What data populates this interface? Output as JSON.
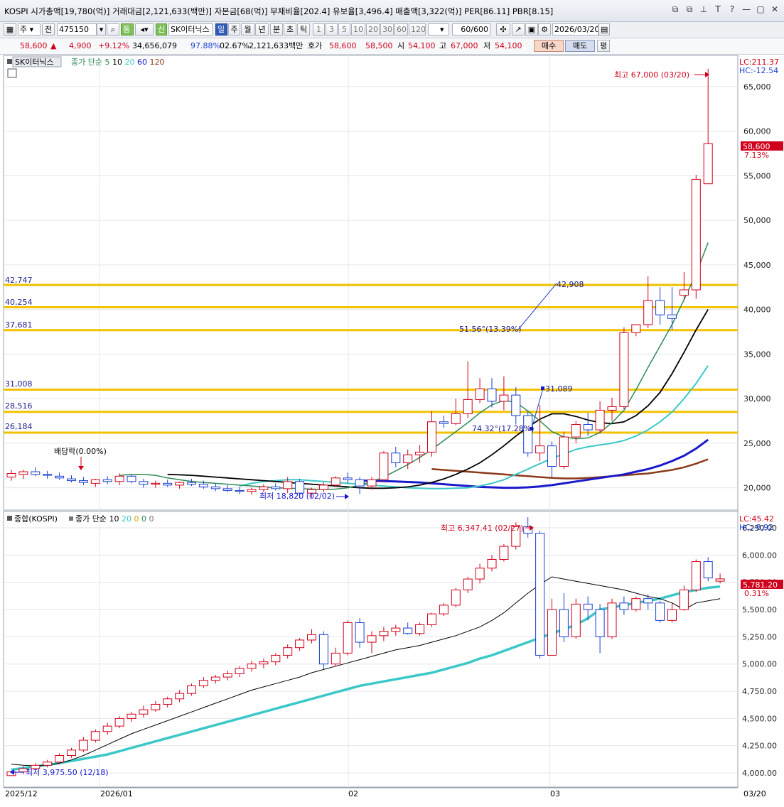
{
  "header": {
    "title": "KOSPI 시가총액[19,780(억)] 거래대금[2,121,633(백만)] 자본금[68(억)] 부채비율[202.4] 유보율[3,496.4] 매출액[3,322(억)] PER[86.11] PBR[8.15]",
    "window_icons": [
      "⧉",
      "⧉",
      "⊥",
      "T",
      "?",
      "—",
      "▢",
      "✕"
    ]
  },
  "toolbar": {
    "period_select": "주",
    "prev_label": "전",
    "code": "475150",
    "tong_label": "통",
    "sin_label": "신",
    "stock_name": "SK이터닉스",
    "period_tabs": [
      "일",
      "주",
      "월",
      "년",
      "분",
      "초",
      "틱"
    ],
    "active_period": "일",
    "interval_buttons": [
      "1",
      "3",
      "5",
      "10",
      "20",
      "30",
      "60",
      "120"
    ],
    "count_value": "60",
    "count_total": "/600",
    "date": "2026/03/20"
  },
  "quote": {
    "price": "58,600",
    "change_arrow": "▲",
    "change": "4,900",
    "change_pct": "+9.12%",
    "volume": "34,656,079",
    "vol_ratio": "97.88%",
    "turnover": "02.67%",
    "amount": "2,121,633백만",
    "hoga_label": "호가",
    "ask": "58,600",
    "bid": "58,500",
    "open_label": "시",
    "open": "54,100",
    "high_label": "고",
    "high": "67,000",
    "low_label": "저",
    "low": "54,100",
    "buy_label": "매수",
    "sell_label": "매도",
    "eval_label": "평"
  },
  "upper_panel": {
    "legend_name": "SK이터닉스",
    "legend_ma": "종가 단순",
    "ma_periods": [
      "5",
      "10",
      "20",
      "60",
      "120"
    ],
    "ma_colors": [
      "#2e8b57",
      "#000000",
      "#3cc8c8",
      "#1a1acc",
      "#8b3a1a"
    ],
    "lc": "LC:211.37",
    "hc": "HC:-12.54",
    "current_price": "58,600",
    "current_pct": "7.13%",
    "high_annotation": "최고 67,000 (03/20)",
    "low_annotation": "최저 18,820 (02/02)",
    "dividend": "배당락(0.00%)",
    "fib_levels": [
      "42,747",
      "40,254",
      "37,681",
      "31,008",
      "28,516",
      "26,184"
    ],
    "trend_label_1": "42,908",
    "trend_label_2": "51.56°(13.39%)",
    "trend_label_3": "31,089",
    "trend_label_4": "74.32°(17.28%)",
    "y_ticks": [
      "65,000",
      "60,000",
      "55,000",
      "50,000",
      "45,000",
      "40,000",
      "35,000",
      "30,000",
      "25,000",
      "20,000"
    ]
  },
  "lower_panel": {
    "legend_name": "종합(KOSPI)",
    "legend_ma": "종가 단순",
    "ma_periods": [
      "10",
      "20",
      "0",
      "0",
      "0"
    ],
    "lc": "LC:45.42",
    "hc": "HC:-8.92",
    "current_value": "5,781.20",
    "current_pct": "0.31%",
    "high_annotation": "최고 6,347.41 (02/27)",
    "low_annotation": "최저 3,975.50 (12/18)",
    "y_ticks": [
      "6,250.00",
      "6,000.00",
      "5,750.00",
      "5,500.00",
      "5,250.00",
      "5,000.00",
      "4,750.00",
      "4,500.00",
      "4,250.00",
      "4,000.00"
    ]
  },
  "x_axis": {
    "labels": [
      "2025/12",
      "2026/01",
      "02",
      "03",
      "03/20"
    ]
  },
  "chart_data": [
    {
      "type": "candlestick",
      "title": "SK이터닉스",
      "ylim": [
        17500,
        68500
      ],
      "x_labels": [
        "2025/12",
        "2026/01",
        "02",
        "03"
      ],
      "ohlc": [
        [
          21200,
          22000,
          20800,
          21600
        ],
        [
          21500,
          22000,
          21000,
          21800
        ],
        [
          21800,
          22300,
          21300,
          21500
        ],
        [
          21500,
          21900,
          21000,
          21400
        ],
        [
          21300,
          21700,
          20900,
          21100
        ],
        [
          21000,
          21400,
          20600,
          20800
        ],
        [
          20800,
          21200,
          20300,
          20600
        ],
        [
          20500,
          21000,
          20100,
          20900
        ],
        [
          20900,
          21300,
          20400,
          20700
        ],
        [
          20700,
          21600,
          20300,
          21300
        ],
        [
          21300,
          21500,
          20500,
          20700
        ],
        [
          20700,
          21000,
          20000,
          20400
        ],
        [
          20400,
          20800,
          20000,
          20500
        ],
        [
          20500,
          20900,
          20100,
          20300
        ],
        [
          20300,
          20700,
          19900,
          20600
        ],
        [
          20600,
          21000,
          20200,
          20400
        ],
        [
          20400,
          20800,
          19900,
          20100
        ],
        [
          20100,
          20500,
          19600,
          19900
        ],
        [
          19900,
          20300,
          19500,
          19700
        ],
        [
          19700,
          20100,
          19300,
          19600
        ],
        [
          19600,
          20000,
          19200,
          19800
        ],
        [
          19800,
          20400,
          19500,
          20100
        ],
        [
          20100,
          20500,
          19700,
          19900
        ],
        [
          19900,
          21200,
          19400,
          20700
        ],
        [
          20700,
          21000,
          18820,
          19400
        ],
        [
          19400,
          20000,
          18900,
          19800
        ],
        [
          19800,
          20600,
          19500,
          20300
        ],
        [
          20300,
          21300,
          20100,
          21100
        ],
        [
          21100,
          21700,
          20500,
          20900
        ],
        [
          20900,
          21200,
          19300,
          20200
        ],
        [
          20200,
          21200,
          19800,
          20900
        ],
        [
          20900,
          24100,
          20700,
          23900
        ],
        [
          23900,
          24600,
          22300,
          22800
        ],
        [
          22800,
          24300,
          22100,
          23700
        ],
        [
          23700,
          24800,
          22800,
          24000
        ],
        [
          24000,
          28600,
          23500,
          27400
        ],
        [
          27400,
          28100,
          26700,
          27200
        ],
        [
          27200,
          30000,
          27000,
          28300
        ],
        [
          28300,
          34200,
          27800,
          29900
        ],
        [
          29900,
          32300,
          29500,
          31100
        ],
        [
          31100,
          32300,
          29000,
          29700
        ],
        [
          29700,
          32500,
          28700,
          30400
        ],
        [
          30400,
          31300,
          27100,
          28100
        ],
        [
          28100,
          28600,
          23500,
          23900
        ],
        [
          23900,
          29300,
          23000,
          24700
        ],
        [
          24700,
          25200,
          21200,
          22400
        ],
        [
          22400,
          26300,
          22100,
          25700
        ],
        [
          25700,
          27500,
          25000,
          27100
        ],
        [
          27100,
          28400,
          25800,
          26500
        ],
        [
          26500,
          29700,
          26100,
          28700
        ],
        [
          28700,
          30100,
          27500,
          29100
        ],
        [
          29100,
          38000,
          28800,
          37400
        ],
        [
          37400,
          38200,
          37000,
          38300
        ],
        [
          38300,
          43700,
          37900,
          41000
        ],
        [
          41000,
          42500,
          38300,
          39400
        ],
        [
          39400,
          42500,
          37700,
          39000
        ],
        [
          41600,
          44200,
          41100,
          42200
        ],
        [
          42200,
          55100,
          41200,
          54600
        ],
        [
          54100,
          67000,
          54100,
          58600
        ]
      ],
      "ma5": [
        21400,
        21500,
        21500,
        21400,
        21100,
        20900,
        20700,
        20600,
        20500,
        20400,
        20300,
        20200,
        20100,
        20000,
        19950,
        19900,
        19850,
        19800,
        19850,
        20000,
        20300,
        20700,
        21200,
        21900,
        22600,
        23400,
        24300,
        25300,
        26300,
        27300,
        28400,
        29300,
        29800,
        29600,
        28600,
        27500,
        26300,
        25700,
        25500,
        25600,
        26200,
        27300,
        28700,
        31000,
        33500,
        35900,
        38300,
        41100,
        44000,
        47500
      ],
      "ma10": [
        21500,
        21450,
        21400,
        21300,
        21200,
        21100,
        21000,
        20900,
        20800,
        20700,
        20600,
        20500,
        20400,
        20300,
        20200,
        20100,
        20000,
        19950,
        19950,
        20000,
        20100,
        20300,
        20600,
        21000,
        21500,
        22100,
        22800,
        23700,
        24700,
        25800,
        26800,
        27700,
        28300,
        28300,
        28000,
        27600,
        27300,
        27200,
        27400,
        28100,
        29200,
        30700,
        32800,
        35200,
        37700,
        40000
      ],
      "ma20": [
        20200,
        20500,
        20700,
        20800,
        20900,
        20900,
        20800,
        20700,
        20600,
        20500,
        20400,
        20300,
        20200,
        20100,
        20000,
        19950,
        19900,
        19900,
        19950,
        20000,
        20200,
        20500,
        20900,
        21500,
        22100,
        22700,
        23300,
        23800,
        24300,
        24600,
        24800,
        25000,
        25300,
        25800,
        26500,
        27400,
        28500,
        30000,
        31700,
        33700
      ],
      "ma60": [
        20800,
        20800,
        20750,
        20700,
        20650,
        20600,
        20500,
        20400,
        20300,
        20200,
        20100,
        20050,
        20000,
        20000,
        20050,
        20150,
        20300,
        20500,
        20700,
        20900,
        21100,
        21300,
        21500,
        21800,
        22100,
        22500,
        23000,
        23600,
        24400,
        25400
      ],
      "ma120": [
        22100,
        22000,
        21900,
        21800,
        21700,
        21600,
        21500,
        21400,
        21300,
        21200,
        21100,
        21050,
        21050,
        21100,
        21200,
        21300,
        21400,
        21500,
        21600,
        21800,
        22000,
        22300,
        22700,
        23200
      ]
    },
    {
      "type": "candlestick",
      "title": "종합(KOSPI)",
      "ylim": [
        3870,
        6400
      ],
      "ohlc": [
        [
          3975.5,
          4020,
          3975.5,
          4010
        ],
        [
          4010,
          4060,
          3990,
          4040
        ],
        [
          4040,
          4090,
          4020,
          4070
        ],
        [
          4070,
          4120,
          4050,
          4100
        ],
        [
          4100,
          4180,
          4080,
          4160
        ],
        [
          4160,
          4230,
          4140,
          4210
        ],
        [
          4210,
          4330,
          4190,
          4300
        ],
        [
          4300,
          4400,
          4280,
          4380
        ],
        [
          4380,
          4460,
          4350,
          4430
        ],
        [
          4430,
          4520,
          4410,
          4500
        ],
        [
          4500,
          4560,
          4470,
          4540
        ],
        [
          4540,
          4620,
          4510,
          4580
        ],
        [
          4580,
          4660,
          4560,
          4630
        ],
        [
          4630,
          4700,
          4600,
          4680
        ],
        [
          4680,
          4760,
          4650,
          4730
        ],
        [
          4730,
          4820,
          4710,
          4800
        ],
        [
          4800,
          4880,
          4780,
          4850
        ],
        [
          4850,
          4900,
          4820,
          4880
        ],
        [
          4880,
          4940,
          4850,
          4910
        ],
        [
          4910,
          4980,
          4880,
          4960
        ],
        [
          4960,
          5030,
          4930,
          5000
        ],
        [
          5000,
          5050,
          4960,
          5020
        ],
        [
          5020,
          5100,
          4990,
          5080
        ],
        [
          5080,
          5180,
          5050,
          5150
        ],
        [
          5150,
          5240,
          5120,
          5220
        ],
        [
          5220,
          5320,
          5190,
          5270
        ],
        [
          5270,
          5300,
          4950,
          5000
        ],
        [
          5000,
          5150,
          4980,
          5100
        ],
        [
          5100,
          5400,
          5080,
          5380
        ],
        [
          5380,
          5420,
          5150,
          5200
        ],
        [
          5200,
          5300,
          5100,
          5260
        ],
        [
          5260,
          5340,
          5210,
          5300
        ],
        [
          5300,
          5360,
          5260,
          5330
        ],
        [
          5330,
          5380,
          5270,
          5280
        ],
        [
          5280,
          5380,
          5260,
          5360
        ],
        [
          5360,
          5470,
          5340,
          5460
        ],
        [
          5460,
          5560,
          5440,
          5540
        ],
        [
          5540,
          5700,
          5520,
          5680
        ],
        [
          5680,
          5800,
          5650,
          5780
        ],
        [
          5780,
          5920,
          5740,
          5880
        ],
        [
          5880,
          6000,
          5850,
          5960
        ],
        [
          5960,
          6100,
          5940,
          6080
        ],
        [
          6080,
          6300,
          6050,
          6260
        ],
        [
          6260,
          6347.41,
          6160,
          6200
        ],
        [
          6200,
          6220,
          5050,
          5080
        ],
        [
          5080,
          5600,
          5080,
          5500
        ],
        [
          5500,
          5650,
          5200,
          5250
        ],
        [
          5250,
          5600,
          5230,
          5550
        ],
        [
          5550,
          5620,
          5400,
          5500
        ],
        [
          5500,
          5550,
          5100,
          5250
        ],
        [
          5250,
          5600,
          5230,
          5560
        ],
        [
          5560,
          5620,
          5450,
          5500
        ],
        [
          5500,
          5620,
          5480,
          5600
        ],
        [
          5600,
          5640,
          5500,
          5560
        ],
        [
          5560,
          5580,
          5380,
          5400
        ],
        [
          5400,
          5560,
          5380,
          5500
        ],
        [
          5500,
          5720,
          5490,
          5680
        ],
        [
          5680,
          5960,
          5660,
          5940
        ],
        [
          5940,
          5980,
          5760,
          5790
        ],
        [
          5760,
          5830,
          5740,
          5781.2
        ]
      ],
      "ma10": [
        4080,
        4070,
        4065,
        4070,
        4090,
        4120,
        4160,
        4210,
        4260,
        4310,
        4360,
        4400,
        4440,
        4480,
        4520,
        4560,
        4600,
        4640,
        4680,
        4720,
        4760,
        4790,
        4820,
        4850,
        4880,
        4920,
        4950,
        4980,
        5010,
        5040,
        5070,
        5100,
        5130,
        5150,
        5170,
        5200,
        5230,
        5260,
        5300,
        5340,
        5400,
        5470,
        5560,
        5650,
        5730,
        5800,
        5780,
        5760,
        5740,
        5720,
        5700,
        5680,
        5650,
        5620,
        5600,
        5560,
        5500,
        5560,
        5580,
        5600
      ],
      "ma20": [
        4030,
        4045,
        4060,
        4075,
        4090,
        4110,
        4130,
        4150,
        4170,
        4200,
        4230,
        4260,
        4290,
        4320,
        4350,
        4380,
        4410,
        4440,
        4470,
        4500,
        4530,
        4560,
        4590,
        4620,
        4650,
        4680,
        4710,
        4740,
        4770,
        4800,
        4820,
        4840,
        4860,
        4880,
        4900,
        4920,
        4950,
        4980,
        5010,
        5050,
        5080,
        5120,
        5160,
        5200,
        5240,
        5280,
        5320,
        5360,
        5420,
        5500,
        5520,
        5540,
        5560,
        5580,
        5600,
        5630,
        5660,
        5680,
        5700,
        5710
      ]
    }
  ]
}
